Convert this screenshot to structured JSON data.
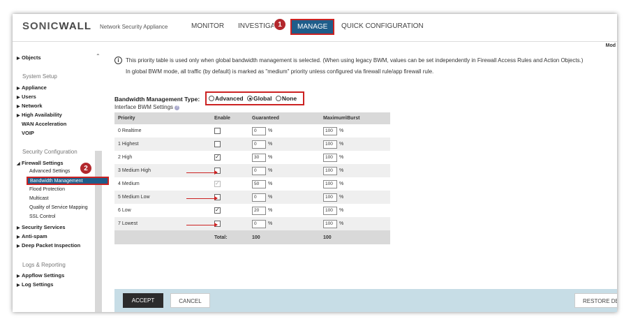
{
  "brand": {
    "logo_part1": "SONIC",
    "logo_part2": "WALL",
    "app_name": "Network Security Appliance"
  },
  "nav": {
    "monitor": "MONITOR",
    "investigate": "INVESTIGA",
    "manage": "MANAGE",
    "quick_config": "QUICK CONFIGURATION"
  },
  "badges": {
    "one": "1",
    "two": "2"
  },
  "mode_label": "Mod",
  "sidebar": {
    "objects": "Objects",
    "system_setup": "System Setup",
    "appliance": "Appliance",
    "users": "Users",
    "network": "Network",
    "high_availability": "High Availability",
    "wan_acceleration": "WAN Acceleration",
    "voip": "VOIP",
    "security_configuration": "Security Configuration",
    "firewall_settings": "Firewall Settings",
    "advanced_settings": "Advanced Settings",
    "bandwidth_management": "Bandwidth Management",
    "flood_protection": "Flood Protection",
    "multicast": "Multicast",
    "qos_mapping": "Quality of Service Mapping",
    "ssl_control": "SSL Control",
    "security_services": "Security Services",
    "anti_spam": "Anti-spam",
    "dpi": "Deep Packet Inspection",
    "logs_reporting": "Logs & Reporting",
    "appflow_settings": "Appflow Settings",
    "log_settings": "Log Settings"
  },
  "info": {
    "line1": "This priority table is used only when global bandwidth management is selected. (When using legacy BWM, values can be set independently in Firewall Access Rules and Action Objects.)",
    "line2": "In global BWM mode, all traffic (by default) is marked as \"medium\" priority unless configured via firewall rule/app firewall rule."
  },
  "bwm": {
    "type_label": "Bandwidth Management Type:",
    "options": {
      "advanced": "Advanced",
      "global": "Global",
      "none": "None"
    },
    "selected": "Global",
    "interface_label": "Interface BWM Settings"
  },
  "table": {
    "headers": {
      "priority": "Priority",
      "enable": "Enable",
      "guaranteed": "Guaranteed",
      "maxburst": "Maximum\\Burst"
    },
    "percent": "%",
    "rows": [
      {
        "priority": "0  Realtime",
        "enabled": false,
        "guaranteed": "0",
        "max": "100"
      },
      {
        "priority": "1  Highest",
        "enabled": false,
        "guaranteed": "0",
        "max": "100"
      },
      {
        "priority": "2  High",
        "enabled": true,
        "guaranteed": "30",
        "max": "100"
      },
      {
        "priority": "3  Medium High",
        "enabled": false,
        "guaranteed": "0",
        "max": "100"
      },
      {
        "priority": "4  Medium",
        "enabled": true,
        "guaranteed": "50",
        "max": "100"
      },
      {
        "priority": "5  Medium Low",
        "enabled": false,
        "guaranteed": "0",
        "max": "100"
      },
      {
        "priority": "6  Low",
        "enabled": true,
        "guaranteed": "20",
        "max": "100"
      },
      {
        "priority": "7  Lowest",
        "enabled": false,
        "guaranteed": "0",
        "max": "100"
      }
    ],
    "total_label": "Total:",
    "total_guaranteed": "100",
    "total_max": "100"
  },
  "buttons": {
    "accept": "ACCEPT",
    "cancel": "CANCEL",
    "restore": "RESTORE DE"
  },
  "colors": {
    "manage_bg": "#1f5d8a",
    "highlight_red": "#cc2222",
    "badge": "#b3282d",
    "bottom_bar": "#c7dde6"
  }
}
